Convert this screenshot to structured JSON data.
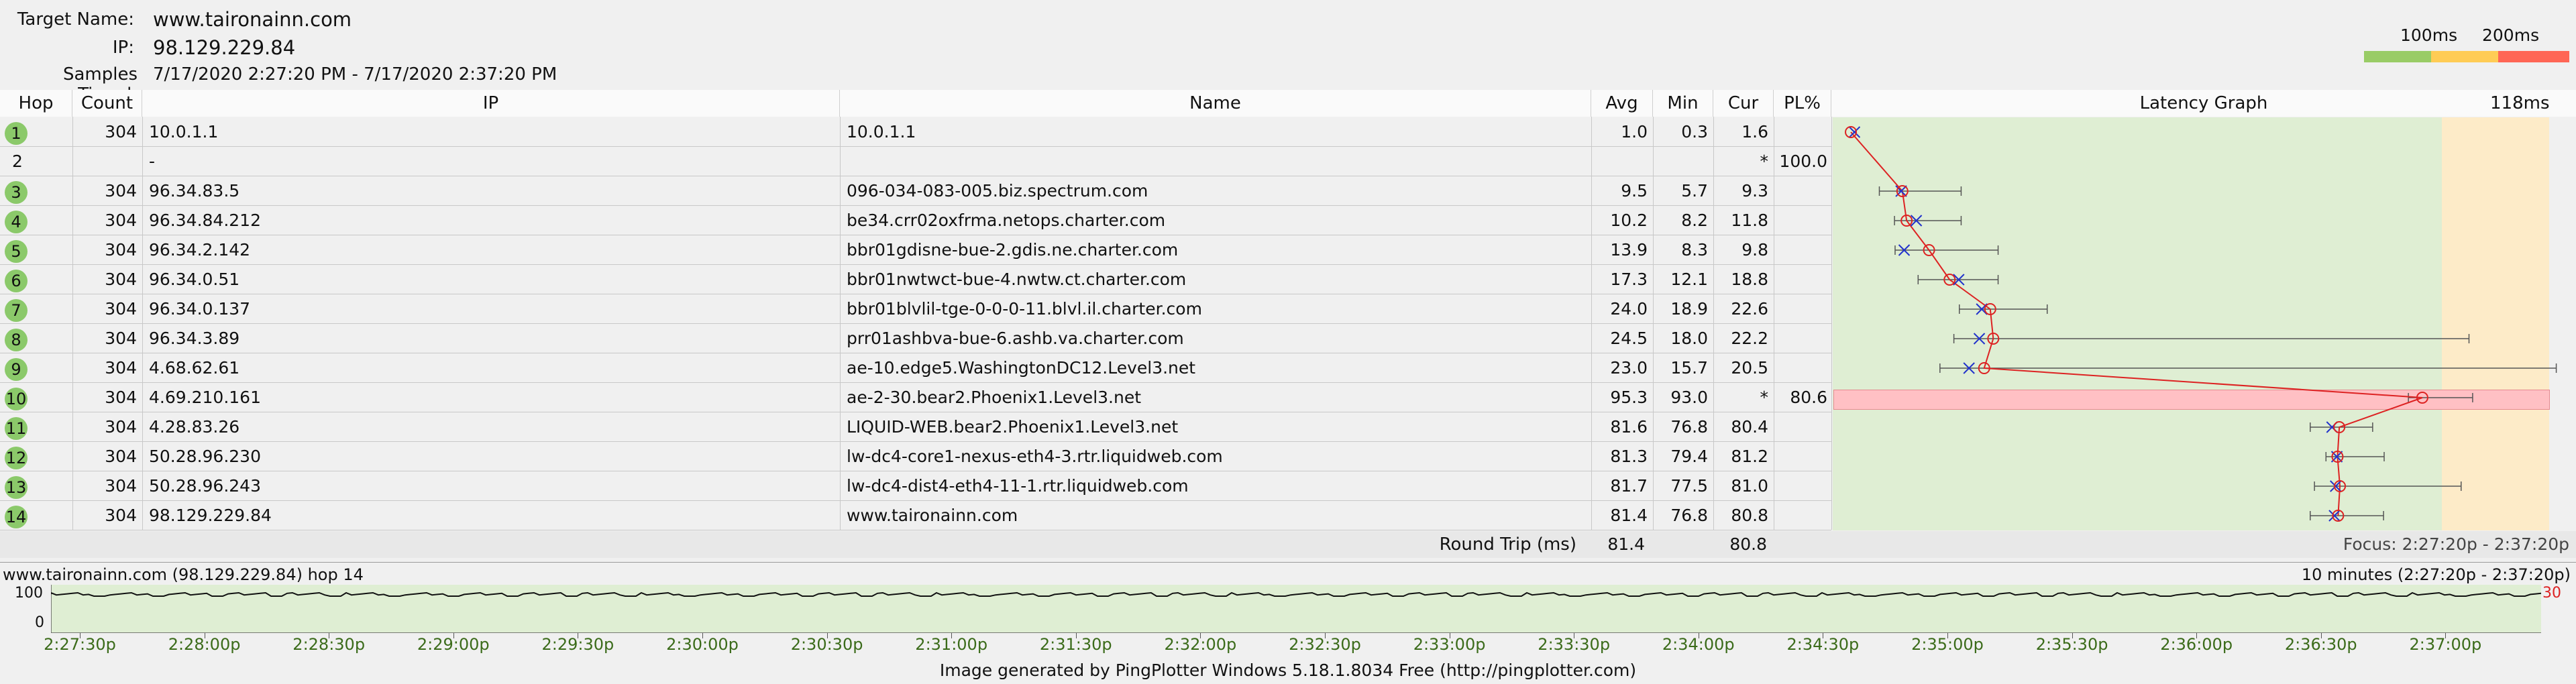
{
  "header": {
    "target_name_label": "Target Name:",
    "target_name": "www.taironainn.com",
    "ip_label": "IP:",
    "ip": "98.129.229.84",
    "samples_label": "Samples Timed:",
    "samples": "7/17/2020 2:27:20 PM - 7/17/2020 2:37:20 PM",
    "legend_100": "100ms",
    "legend_200": "200ms",
    "legend_colors": [
      "#99cc66",
      "#ffcc55",
      "#ff6655"
    ]
  },
  "columns": {
    "hop": "Hop",
    "count": "Count",
    "ip": "IP",
    "name": "Name",
    "avg": "Avg",
    "min": "Min",
    "cur": "Cur",
    "pl": "PL%",
    "graph": "Latency Graph",
    "graph_max": "118ms"
  },
  "rows": [
    {
      "hop": "1",
      "count": "304",
      "ip": "10.0.1.1",
      "name": "10.0.1.1",
      "avg": "1.0",
      "min": "0.3",
      "cur": "1.6",
      "pl": "",
      "badge": true
    },
    {
      "hop": "2",
      "count": "",
      "ip": "-",
      "name": "",
      "avg": "",
      "min": "",
      "cur": "*",
      "pl": "100.0",
      "badge": false
    },
    {
      "hop": "3",
      "count": "304",
      "ip": "96.34.83.5",
      "name": "096-034-083-005.biz.spectrum.com",
      "avg": "9.5",
      "min": "5.7",
      "cur": "9.3",
      "pl": "",
      "badge": true
    },
    {
      "hop": "4",
      "count": "304",
      "ip": "96.34.84.212",
      "name": "be34.crr02oxfrma.netops.charter.com",
      "avg": "10.2",
      "min": "8.2",
      "cur": "11.8",
      "pl": "",
      "badge": true
    },
    {
      "hop": "5",
      "count": "304",
      "ip": "96.34.2.142",
      "name": "bbr01gdisne-bue-2.gdis.ne.charter.com",
      "avg": "13.9",
      "min": "8.3",
      "cur": "9.8",
      "pl": "",
      "badge": true
    },
    {
      "hop": "6",
      "count": "304",
      "ip": "96.34.0.51",
      "name": "bbr01nwtwct-bue-4.nwtw.ct.charter.com",
      "avg": "17.3",
      "min": "12.1",
      "cur": "18.8",
      "pl": "",
      "badge": true
    },
    {
      "hop": "7",
      "count": "304",
      "ip": "96.34.0.137",
      "name": "bbr01blvlil-tge-0-0-0-11.blvl.il.charter.com",
      "avg": "24.0",
      "min": "18.9",
      "cur": "22.6",
      "pl": "",
      "badge": true
    },
    {
      "hop": "8",
      "count": "304",
      "ip": "96.34.3.89",
      "name": "prr01ashbva-bue-6.ashb.va.charter.com",
      "avg": "24.5",
      "min": "18.0",
      "cur": "22.2",
      "pl": "",
      "badge": true
    },
    {
      "hop": "9",
      "count": "304",
      "ip": "4.68.62.61",
      "name": "ae-10.edge5.WashingtonDC12.Level3.net",
      "avg": "23.0",
      "min": "15.7",
      "cur": "20.5",
      "pl": "",
      "badge": true
    },
    {
      "hop": "10",
      "count": "304",
      "ip": "4.69.210.161",
      "name": "ae-2-30.bear2.Phoenix1.Level3.net",
      "avg": "95.3",
      "min": "93.0",
      "cur": "*",
      "pl": "80.6",
      "badge": true
    },
    {
      "hop": "11",
      "count": "304",
      "ip": "4.28.83.26",
      "name": "LIQUID-WEB.bear2.Phoenix1.Level3.net",
      "avg": "81.6",
      "min": "76.8",
      "cur": "80.4",
      "pl": "",
      "badge": true
    },
    {
      "hop": "12",
      "count": "304",
      "ip": "50.28.96.230",
      "name": "lw-dc4-core1-nexus-eth4-3.rtr.liquidweb.com",
      "avg": "81.3",
      "min": "79.4",
      "cur": "81.2",
      "pl": "",
      "badge": true
    },
    {
      "hop": "13",
      "count": "304",
      "ip": "50.28.96.243",
      "name": "lw-dc4-dist4-eth4-11-1.rtr.liquidweb.com",
      "avg": "81.7",
      "min": "77.5",
      "cur": "81.0",
      "pl": "",
      "badge": true
    },
    {
      "hop": "14",
      "count": "304",
      "ip": "98.129.229.84",
      "name": "www.taironainn.com",
      "avg": "81.4",
      "min": "76.8",
      "cur": "80.8",
      "pl": "",
      "badge": true
    }
  ],
  "latency_graph": {
    "axis_max_ms": 118,
    "marks": [
      {
        "avg": 1.0,
        "cur": 1.6,
        "max": 1.6
      },
      null,
      {
        "avg": 9.5,
        "cur": 9.3,
        "min": 5.7,
        "max": 19.2
      },
      {
        "avg": 10.2,
        "cur": 11.8,
        "min": 8.2,
        "max": 19.2
      },
      {
        "avg": 13.9,
        "cur": 9.8,
        "min": 8.3,
        "max": 25.3
      },
      {
        "avg": 17.3,
        "cur": 18.8,
        "min": 12.1,
        "max": 25.3
      },
      {
        "avg": 24.0,
        "cur": 22.6,
        "min": 18.9,
        "max": 33.4
      },
      {
        "avg": 24.5,
        "cur": 22.2,
        "min": 18.0,
        "max": 103.0
      },
      {
        "avg": 23.0,
        "cur": 20.5,
        "min": 15.7,
        "max": 117.4
      },
      {
        "avg": 95.3,
        "min": 93.0,
        "max": 103.6,
        "loss": true
      },
      {
        "avg": 81.6,
        "cur": 80.4,
        "min": 76.8,
        "max": 87.1
      },
      {
        "avg": 81.3,
        "cur": 81.2,
        "min": 79.4,
        "max": 89.0
      },
      {
        "avg": 81.7,
        "cur": 81.0,
        "min": 77.5,
        "max": 101.7
      },
      {
        "avg": 81.4,
        "cur": 80.8,
        "min": 76.8,
        "max": 88.9
      }
    ]
  },
  "summary": {
    "round_trip_label": "Round Trip (ms)",
    "avg": "81.4",
    "cur": "80.8",
    "focus": "Focus: 2:27:20p - 2:37:20p"
  },
  "timeline": {
    "title": "www.taironainn.com (98.129.229.84) hop 14",
    "range": "10 minutes (2:27:20p - 2:37:20p)",
    "y_top": "100",
    "y_bottom": "0",
    "right_value": "30",
    "ticks": [
      "2:27:30p",
      "2:28:00p",
      "2:28:30p",
      "2:29:00p",
      "2:29:30p",
      "2:30:00p",
      "2:30:30p",
      "2:31:00p",
      "2:31:30p",
      "2:32:00p",
      "2:32:30p",
      "2:33:00p",
      "2:33:30p",
      "2:34:00p",
      "2:34:30p",
      "2:35:00p",
      "2:35:30p",
      "2:36:00p",
      "2:36:30p",
      "2:37:00p"
    ]
  },
  "footer": "Image generated by PingPlotter Windows 5.18.1.8034 Free (http://pingplotter.com)"
}
